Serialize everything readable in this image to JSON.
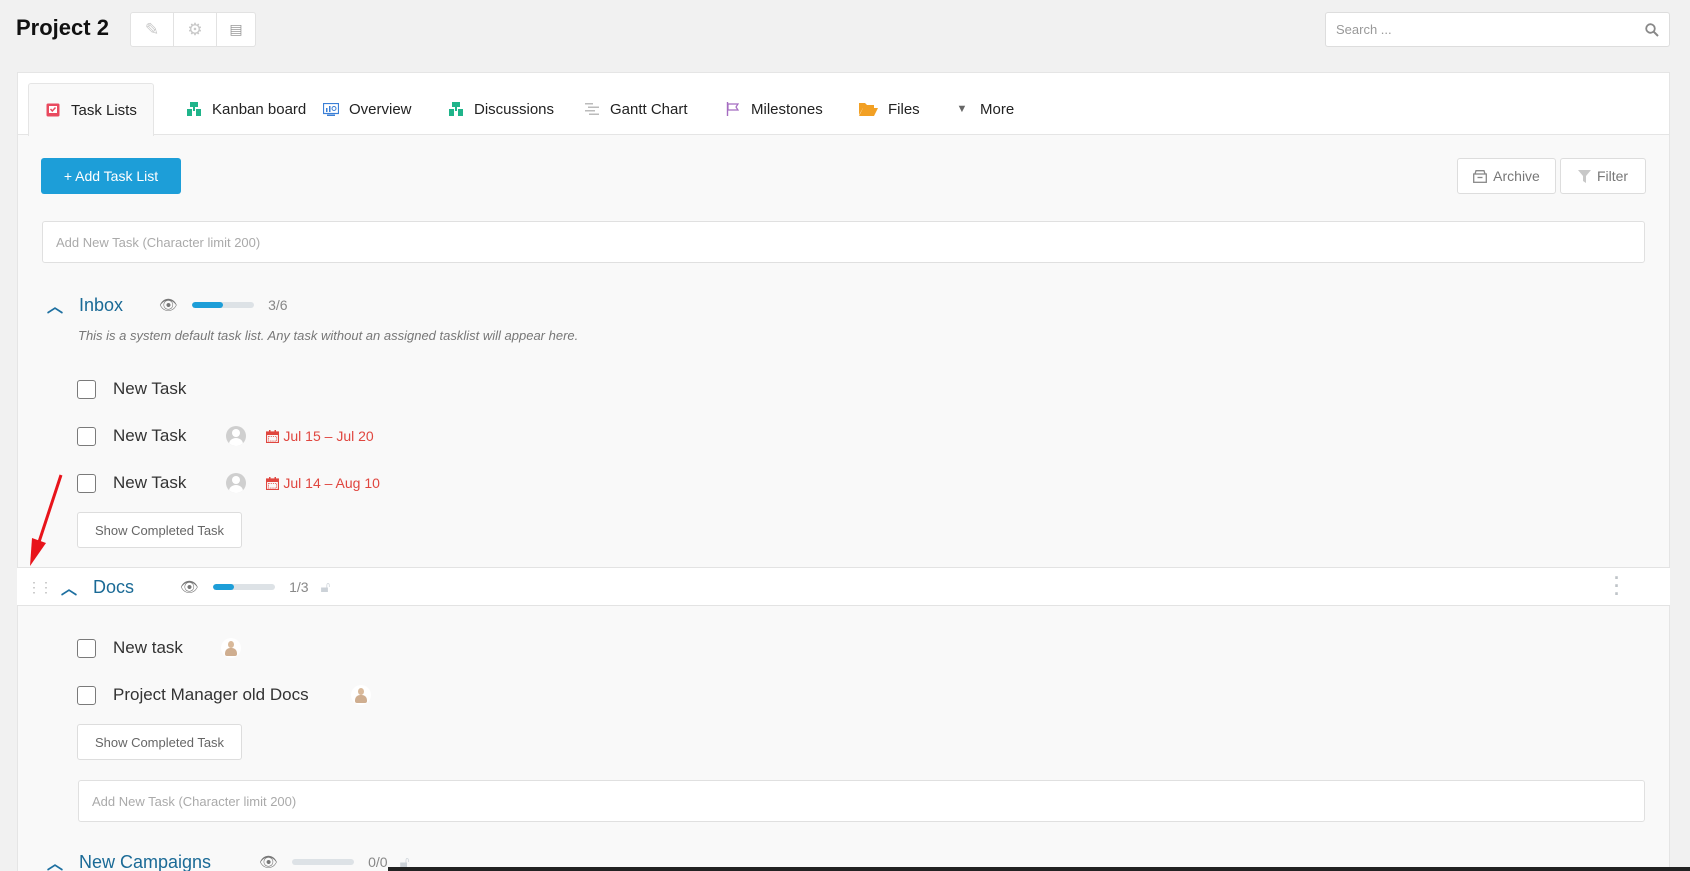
{
  "header": {
    "project_title": "Project 2",
    "actions": [
      {
        "name": "edit-icon",
        "glyph": "✎"
      },
      {
        "name": "gear-icon",
        "glyph": "⚙"
      },
      {
        "name": "document-icon",
        "glyph": "▤"
      }
    ],
    "search": {
      "placeholder": "Search ...",
      "value": ""
    }
  },
  "tabs": [
    {
      "label": "Task Lists",
      "icon": "task-list-icon",
      "color": "#e94a5f",
      "active": true
    },
    {
      "label": "Kanban board",
      "icon": "kanban-icon",
      "color": "#1fb48a"
    },
    {
      "label": "Overview",
      "icon": "overview-icon",
      "color": "#3b7fd6"
    },
    {
      "label": "Discussions",
      "icon": "discussions-icon",
      "color": "#1fb48a"
    },
    {
      "label": "Gantt Chart",
      "icon": "gantt-icon",
      "color": "#bbbbbb"
    },
    {
      "label": "Milestones",
      "icon": "flag-icon",
      "color": "#a56cc1"
    },
    {
      "label": "Files",
      "icon": "folder-icon",
      "color": "#f2a024"
    },
    {
      "label": "More",
      "icon": "caret-down-icon",
      "color": "#666666"
    }
  ],
  "toolbar": {
    "add_task_list": "+ Add Task List",
    "archive": "Archive",
    "filter": "Filter"
  },
  "new_task_placeholder": "Add New Task (Character limit 200)",
  "lists": [
    {
      "title": "Inbox",
      "progress": {
        "done": 3,
        "total": 6,
        "label": "3/6",
        "fraction": 0.5
      },
      "description": "This is a system default task list. Any task without an assigned tasklist will appear here.",
      "tasks": [
        {
          "title": "New Task",
          "assignee": null,
          "due": null
        },
        {
          "title": "New Task",
          "assignee": "default-avatar",
          "due": "Jul 15 – Jul 20"
        },
        {
          "title": "New Task",
          "assignee": "default-avatar",
          "due": "Jul 14 – Aug 10"
        }
      ],
      "show_completed": "Show Completed Task"
    },
    {
      "title": "Docs",
      "progress": {
        "done": 1,
        "total": 3,
        "label": "1/3",
        "fraction": 0.333
      },
      "tasks": [
        {
          "title": "New task",
          "assignee": "user-avatar"
        },
        {
          "title": "Project Manager old Docs",
          "assignee": "user-avatar"
        }
      ],
      "show_completed": "Show Completed Task"
    },
    {
      "title": "New Campaigns",
      "progress": {
        "done": 0,
        "total": 0,
        "label": "0/0",
        "fraction": 0
      }
    }
  ],
  "colors": {
    "primary": "#1d9ed8",
    "list_title": "#1a6a96",
    "due_date": "#e0463f"
  }
}
